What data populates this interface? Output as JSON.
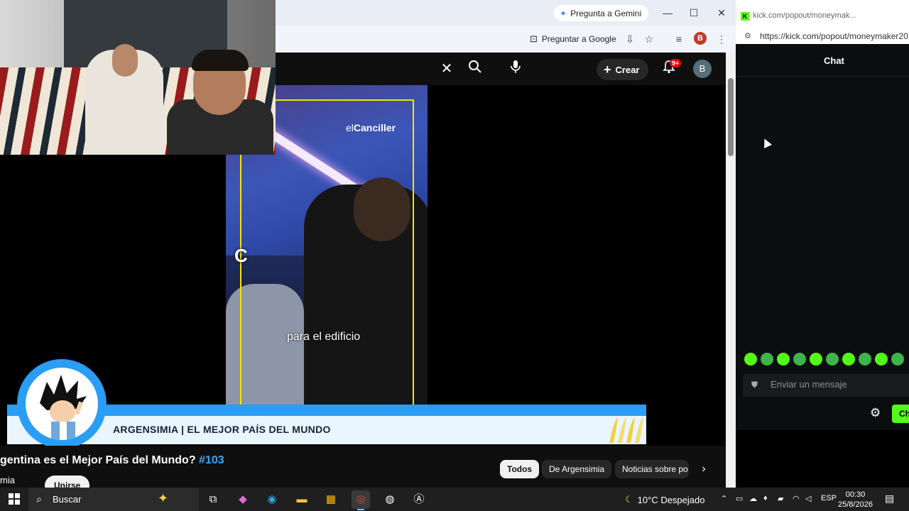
{
  "browser": {
    "gemini_label": "Pregunta a Gemini",
    "ask_google_label": "Preguntar a Google",
    "profile_letter": "B"
  },
  "youtube": {
    "create_label": "Crear",
    "notif_count": "9+",
    "avatar_letter": "B",
    "video": {
      "watermark_prefix": "el",
      "watermark_brand": "Canciller",
      "subtitle": "para el edificio",
      "overlay_letter": "C"
    },
    "banner_text": "ARGENSIMIA | EL MEJOR PAÍS DEL MUNDO",
    "title_text": "gentina es el Mejor País del Mundo? ",
    "title_tag": "#103",
    "channel_name": "mia",
    "join_label": "Unirse",
    "chips": [
      "Todos",
      "De Argensimia",
      "Noticias sobre po"
    ]
  },
  "kick": {
    "title_text": "kick.com/popout/moneymak...",
    "url": "https://kick.com/popout/moneymaker20",
    "chat_label": "Chat",
    "message_placeholder": "Enviar un mensaje",
    "chat_button": "Ch"
  },
  "taskbar": {
    "search_placeholder": "Buscar",
    "weather": "10°C  Despejado",
    "language": "ESP",
    "time": "00:30",
    "date": "25/8/2026"
  },
  "colors": {
    "kick_green": "#53fc18",
    "youtube_link": "#3ea6ff",
    "banner_blue": "#2a9df4"
  }
}
